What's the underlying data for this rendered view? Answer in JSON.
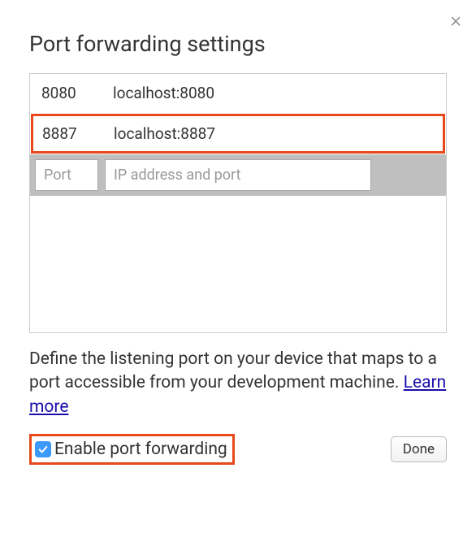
{
  "dialog": {
    "title": "Port forwarding settings",
    "close_glyph": "×"
  },
  "rows": [
    {
      "port": "8080",
      "address": "localhost:8080",
      "highlighted": false
    },
    {
      "port": "8887",
      "address": "localhost:8887",
      "highlighted": true
    }
  ],
  "inputs": {
    "port_placeholder": "Port",
    "address_placeholder": "IP address and port"
  },
  "description": {
    "text": "Define the listening port on your device that maps to a port accessible from your development machine. ",
    "learn_more": "Learn more"
  },
  "footer": {
    "checkbox_label": "Enable port forwarding",
    "checkbox_checked": true,
    "done_label": "Done"
  }
}
